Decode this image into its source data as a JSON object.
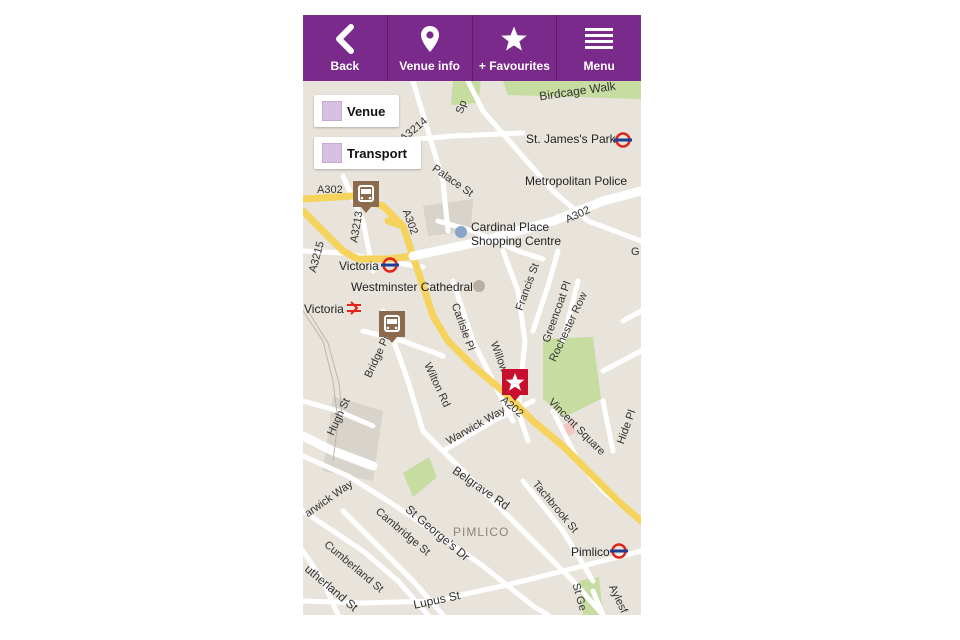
{
  "navbar": {
    "back_label": "Back",
    "venue_info_label": "Venue info",
    "favourites_label": "+ Favourites",
    "menu_label": "Menu",
    "accent": "#7a2a8a"
  },
  "legend": {
    "venue_label": "Venue",
    "transport_label": "Transport",
    "swatch_color": "#d6bfe0"
  },
  "map": {
    "labels": {
      "birdcage_walk": "Birdcage Walk",
      "st_james_park": "St. James's Park",
      "metropolitan_police": "Metropolitan Police",
      "palace_st": "Palace St",
      "cardinal_place_1": "Cardinal Place",
      "cardinal_place_2": "Shopping Centre",
      "victoria_tube": "Victoria",
      "victoria_rail": "Victoria",
      "westminster_cathedral": "Westminster Cathedral",
      "a302_left": "A302",
      "a302_right": "A302",
      "a302_vert": "A302",
      "a3214": "A3214",
      "a3215": "A3215",
      "a3213": "A3213",
      "a202": "A202",
      "francis_st": "Francis St",
      "greencoat_pl": "Greencoat Pl",
      "rochester_row": "Rochester Row",
      "carlisle_pl": "Carlisle Pl",
      "willow": "Willow",
      "bridge_pl": "Bridge Pl",
      "wilton_rd": "Wilton Rd",
      "hugh_st": "Hugh St",
      "warwick_way": "Warwick Way",
      "warwick_way_left": "arwick Way",
      "vincent_square": "Vincent Square",
      "hide_pl": "Hide Pl",
      "belgrave_rd": "Belgrave Rd",
      "tachbrook_st": "Tachbrook St",
      "pimlico_area": "PIMLICO",
      "pimlico_tube": "Pimlico",
      "cambridge_st": "Cambridge St",
      "st_georges_dr": "St George's Dr",
      "cumberland_st": "Cumberland St",
      "sutherland_st": "utherland St",
      "lupus_st": "Lupus St",
      "st_ge": "St Ge",
      "aylesf": "Aylesf",
      "sp": "Sp",
      "g": "G"
    },
    "colors": {
      "land": "#e8e4dc",
      "road": "#ffffff",
      "major_road": "#f5d35c",
      "park": "#c6dca0",
      "building": "#d8d3cb",
      "venue_pin": "#c8102e",
      "transport_pin": "#8c6a4e"
    }
  }
}
